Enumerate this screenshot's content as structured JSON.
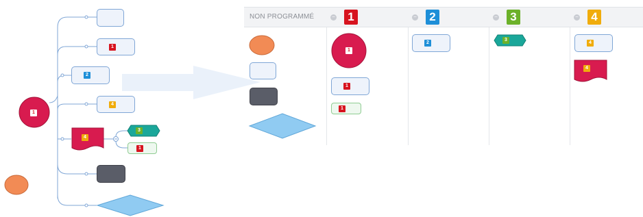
{
  "colors": {
    "line": "#7fa6d6",
    "priority_1": "#d7141f",
    "priority_2": "#1e8fd8",
    "priority_3": "#6cb12a",
    "priority_4": "#f0ac0c",
    "circle_node": "#d81b4f",
    "orange_node": "#f28b55",
    "dark_node": "#5a5d68",
    "diamond_node": "#90cbf2",
    "hexagon_node": "#1aa79a",
    "header_bg": "#f2f3f5"
  },
  "mindmap": {
    "central_topic_badge": "1",
    "floating_topic_badge": "",
    "branches": [
      {
        "shape": "rounded-box",
        "badge": ""
      },
      {
        "shape": "rounded-box",
        "badge": "1"
      },
      {
        "shape": "rounded-box",
        "badge": "2"
      },
      {
        "shape": "rounded-box",
        "badge": "4"
      },
      {
        "shape": "wave-flag",
        "badge": "4",
        "children": [
          {
            "shape": "hexagon",
            "badge": "3"
          },
          {
            "shape": "rounded-box-green",
            "badge": "1"
          }
        ]
      },
      {
        "shape": "dark-box",
        "badge": ""
      },
      {
        "shape": "diamond",
        "badge": ""
      }
    ]
  },
  "board": {
    "columns": [
      {
        "title": "NON PROGRAMMÉ",
        "badge": ""
      },
      {
        "title": "",
        "badge": "1"
      },
      {
        "title": "",
        "badge": "2"
      },
      {
        "title": "",
        "badge": "3"
      },
      {
        "title": "",
        "badge": "4"
      }
    ],
    "cards": {
      "col1_circle_badge": "1",
      "col1_box_badge": "1",
      "col1_green_badge": "1",
      "col2_box_badge": "2",
      "col3_hex_badge": "3",
      "col4_box_badge": "4",
      "col4_flag_badge": "4"
    }
  }
}
